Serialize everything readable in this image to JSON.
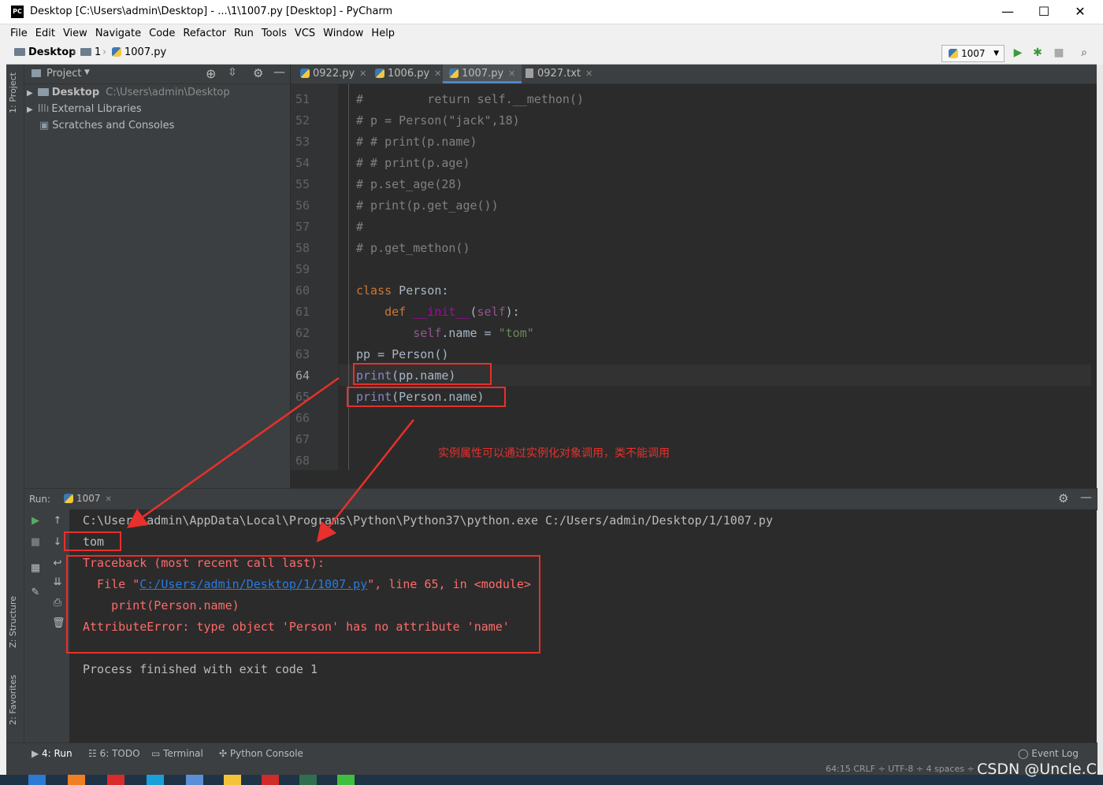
{
  "window": {
    "title": "Desktop [C:\\Users\\admin\\Desktop] - ...\\1\\1007.py [Desktop] - PyCharm",
    "logo_text": "PC",
    "controls": [
      "—",
      "☐",
      "✕"
    ]
  },
  "menu": [
    "File",
    "Edit",
    "View",
    "Navigate",
    "Code",
    "Refactor",
    "Run",
    "Tools",
    "VCS",
    "Window",
    "Help"
  ],
  "breadcrumb": [
    "Desktop",
    "1",
    "1007.py"
  ],
  "toolbar": {
    "run_config": "1007"
  },
  "project": {
    "header": "Project",
    "items": [
      {
        "name": "Desktop",
        "path": "C:\\Users\\admin\\Desktop"
      },
      {
        "name": "External Libraries"
      },
      {
        "name": "Scratches and Consoles"
      }
    ]
  },
  "side_labels": {
    "project": "1: Project",
    "structure": "Z: Structure",
    "favorites": "2: Favorites"
  },
  "tabs": [
    {
      "label": "0922.py"
    },
    {
      "label": "1006.py"
    },
    {
      "label": "1007.py",
      "active": true
    },
    {
      "label": "0927.txt"
    }
  ],
  "editor": {
    "line_numbers": [
      "51",
      "52",
      "53",
      "54",
      "55",
      "56",
      "57",
      "58",
      "59",
      "60",
      "61",
      "62",
      "63",
      "64",
      "65",
      "66",
      "67",
      "68"
    ],
    "current_line": "64",
    "lines": {
      "l51": "#         return self.__methon()",
      "l52": "# p = Person(\"jack\",18)",
      "l53": "# # print(p.name)",
      "l54": "# # print(p.age)",
      "l55": "# p.set_age(28)",
      "l56": "# print(p.get_age())",
      "l57": "#",
      "l58": "# p.get_methon()",
      "l60_kw": "class",
      "l60_name": " Person:",
      "l61_kw": "def",
      "l61_fn": "__init__",
      "l61_open": "(",
      "l61_self": "self",
      "l61_close": "):",
      "l62_self": "self",
      "l62_rest": ".name = ",
      "l62_str": "\"tom\"",
      "l63": "pp = Person()",
      "l64_fn": "print",
      "l64_rest": "(pp.name)",
      "l65_fn": "print",
      "l65_rest": "(Person.name)"
    }
  },
  "annotation": "实例属性可以通过实例化对象调用，类不能调用",
  "run": {
    "label": "Run:",
    "tab": "1007",
    "output": {
      "cmd": "C:\\Users\\admin\\AppData\\Local\\Programs\\Python\\Python37\\python.exe C:/Users/admin/Desktop/1/1007.py",
      "tom": "tom",
      "tb": "Traceback (most recent call last):",
      "file_pre": "  File \"",
      "file_link": "C:/Users/admin/Desktop/1/1007.py",
      "file_post": "\", line 65, in <module>",
      "code": "    print(Person.name)",
      "error": "AttributeError: type object 'Person' has no attribute 'name'",
      "exit": "Process finished with exit code 1"
    }
  },
  "bottom_tabs": [
    "4: Run",
    "6: TODO",
    "Terminal",
    "Python Console"
  ],
  "event_log": "Event Log",
  "status": "64:15   CRLF ÷   UTF-8 ÷   4 spaces ÷",
  "watermark": "CSDN @Uncle.Ci",
  "colors": {
    "accent": "#4a88c7",
    "error": "#ff6b68",
    "annotation": "#e8302c"
  }
}
